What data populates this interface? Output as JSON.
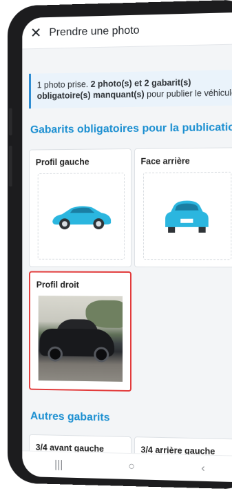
{
  "header": {
    "title": "Prendre une photo"
  },
  "info": {
    "lead": "1 photo prise. ",
    "bold": "2 photo(s) et 2 gabarit(s) obligatoire(s) manquant(s)",
    "tail": " pour publier le véhicule."
  },
  "mandatory": {
    "title": "Gabarits obligatoires pour la publication",
    "cards": [
      {
        "label": "Profil gauche"
      },
      {
        "label": "Face arrière"
      },
      {
        "label": "Profil droit"
      }
    ]
  },
  "other": {
    "title": "Autres gabarits",
    "cards": [
      {
        "label": "3/4 avant gauche"
      },
      {
        "label": "3/4 arrière gauche"
      }
    ]
  },
  "nav": {
    "recent": "|||",
    "home": "○",
    "back": "‹"
  },
  "colors": {
    "accent": "#1b8fd1",
    "car": "#2bb6df",
    "selected_border": "#e23b3b",
    "info_bar": "#2a8ad0"
  }
}
